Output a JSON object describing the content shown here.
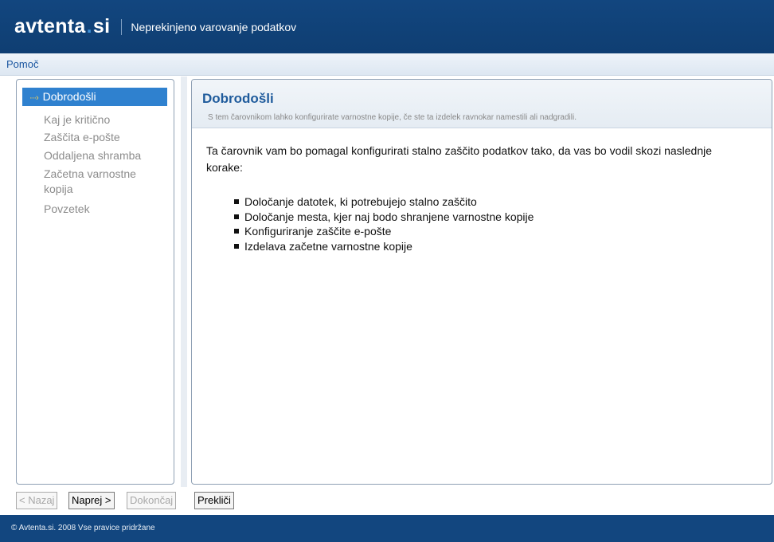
{
  "header": {
    "logo_name": "avtenta",
    "logo_dot": ".",
    "logo_tld": "si",
    "tagline": "Neprekinjeno varovanje podatkov"
  },
  "menu": {
    "help": "Pomoč"
  },
  "sidebar": {
    "items": [
      {
        "arrow": "···›",
        "label": "Dobrodošli"
      },
      {
        "label": "Kaj je kritično"
      },
      {
        "label": "Zaščita e-pošte"
      },
      {
        "label": "Oddaljena shramba"
      },
      {
        "label": "Začetna varnostne kopija"
      },
      {
        "label": "Povzetek"
      }
    ]
  },
  "main": {
    "title": "Dobrodošli",
    "subtitle": "S tem čarovnikom lahko konfigurirate varnostne kopije, če ste ta izdelek ravnokar namestili ali nadgradili.",
    "intro": "Ta čarovnik vam bo pomagal konfigurirati stalno zaščito podatkov tako, da vas bo vodil skozi naslednje korake:",
    "steps": [
      "Določanje datotek, ki potrebujejo stalno zaščito",
      "Določanje mesta, kjer naj bodo shranjene varnostne kopije",
      "Konfiguriranje zaščite e-pošte",
      "Izdelava začetne varnostne kopije"
    ]
  },
  "buttons": {
    "back": "< Nazaj",
    "next": "Naprej >",
    "finish": "Dokončaj",
    "cancel": "Prekliči"
  },
  "footer": {
    "copyright": "© Avtenta.si. 2008 Vse pravice pridržane"
  },
  "colors": {
    "header_bg": "#12467f",
    "accent": "#2f81cf",
    "title": "#1f5b9c"
  }
}
